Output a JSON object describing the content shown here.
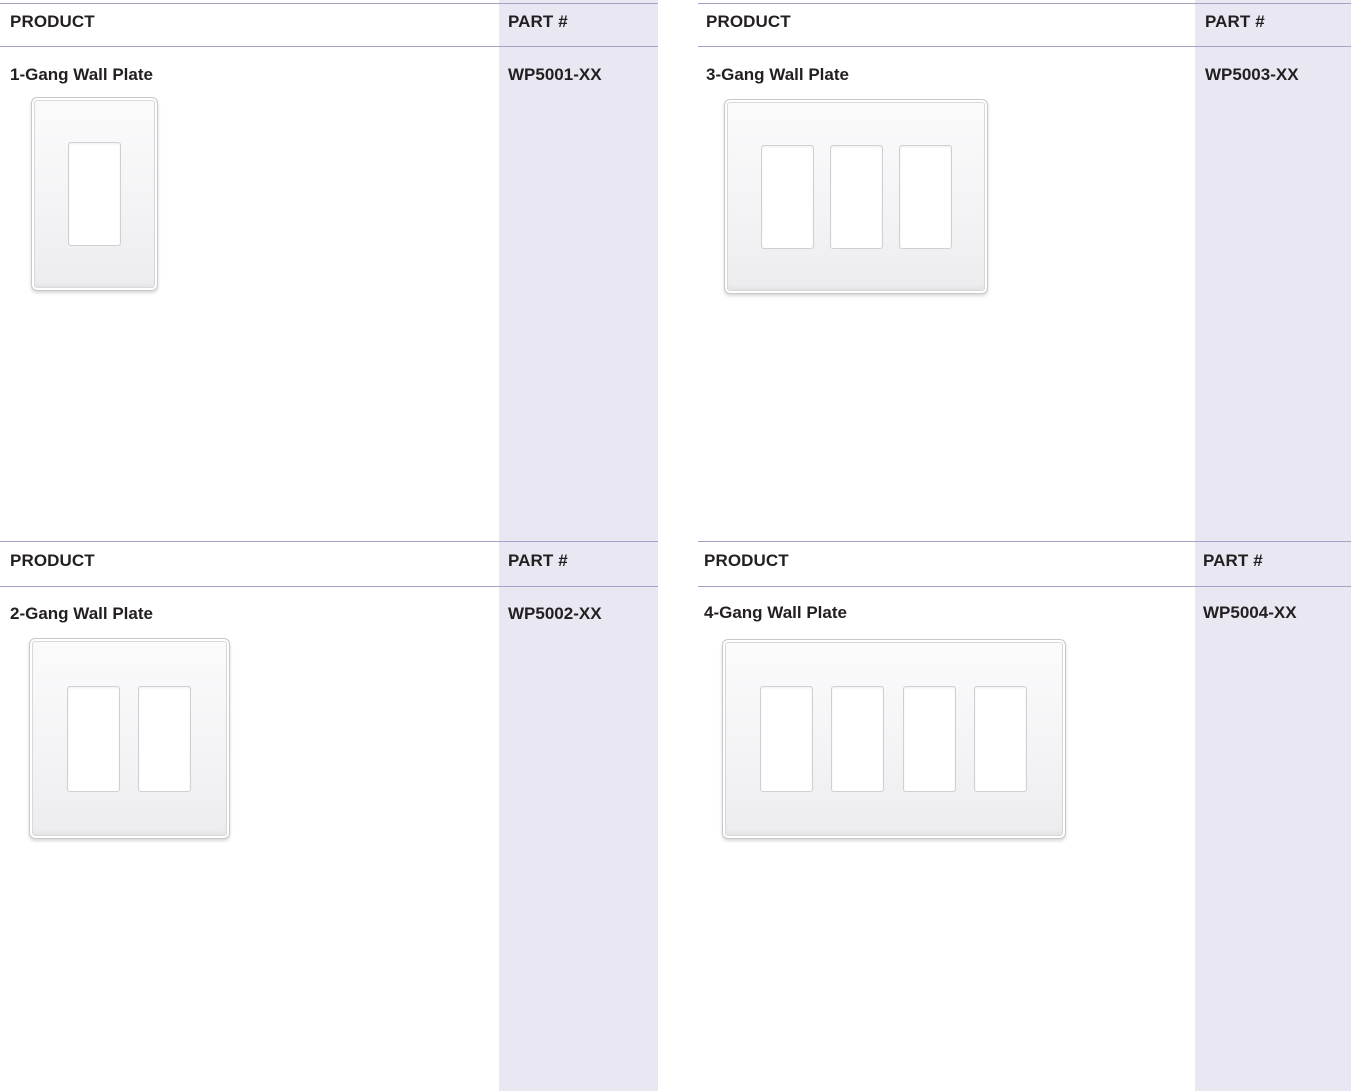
{
  "header": {
    "product_label": "PRODUCT",
    "part_label": "PART #"
  },
  "items": [
    {
      "name": "1-Gang Wall Plate",
      "part": "WP5001-XX",
      "gangs": 1
    },
    {
      "name": "3-Gang Wall Plate",
      "part": "WP5003-XX",
      "gangs": 3
    },
    {
      "name": "2-Gang Wall Plate",
      "part": "WP5002-XX",
      "gangs": 2
    },
    {
      "name": "4-Gang Wall Plate",
      "part": "WP5004-XX",
      "gangs": 4
    }
  ],
  "colors": {
    "part_column_bg": "#e9e8f2",
    "rule": "#a6a2c6",
    "text": "#231f20"
  }
}
